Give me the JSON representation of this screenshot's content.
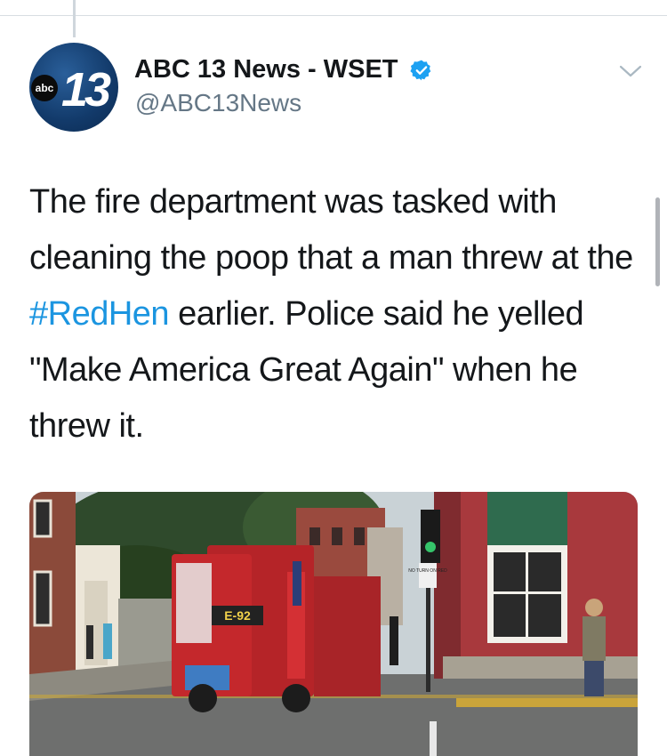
{
  "account": {
    "avatar_badge": "abc",
    "avatar_number": "13",
    "display_name": "ABC 13 News - WSET",
    "handle": "@ABC13News"
  },
  "tweet": {
    "text_part1": "The fire department was tasked with cleaning the poop that a man threw at the ",
    "hashtag": "#RedHen",
    "text_part2": " earlier. Police said he yelled \"Make America Great Again\" when he threw it."
  },
  "media": {
    "truck_plate": "E-92",
    "sign_text": "NO TURN ON RED"
  },
  "colors": {
    "link": "#1b95e0",
    "verified": "#1da1f2",
    "handle": "#657786",
    "building_red": "#a8393d"
  }
}
